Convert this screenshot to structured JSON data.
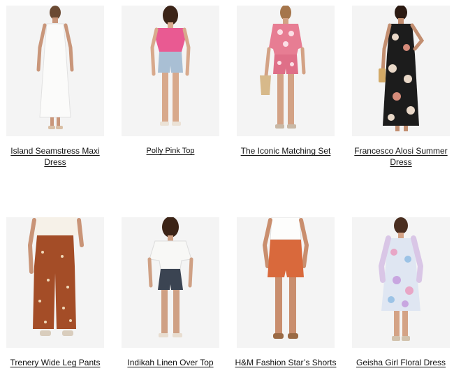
{
  "products": [
    {
      "name": "Island Seamstress Maxi Dress"
    },
    {
      "name": "Polly Pink Top"
    },
    {
      "name": "The Iconic Matching Set"
    },
    {
      "name": "Francesco Alosi Summer Dress"
    },
    {
      "name": "Trenery Wide Leg Pants"
    },
    {
      "name": "Indikah Linen Over Top"
    },
    {
      "name": "H&M Fashion Star’s Shorts"
    },
    {
      "name": "Geisha Girl Floral Dress"
    }
  ],
  "colors": {
    "photo_background": "#f4f4f4",
    "text": "#111111"
  }
}
